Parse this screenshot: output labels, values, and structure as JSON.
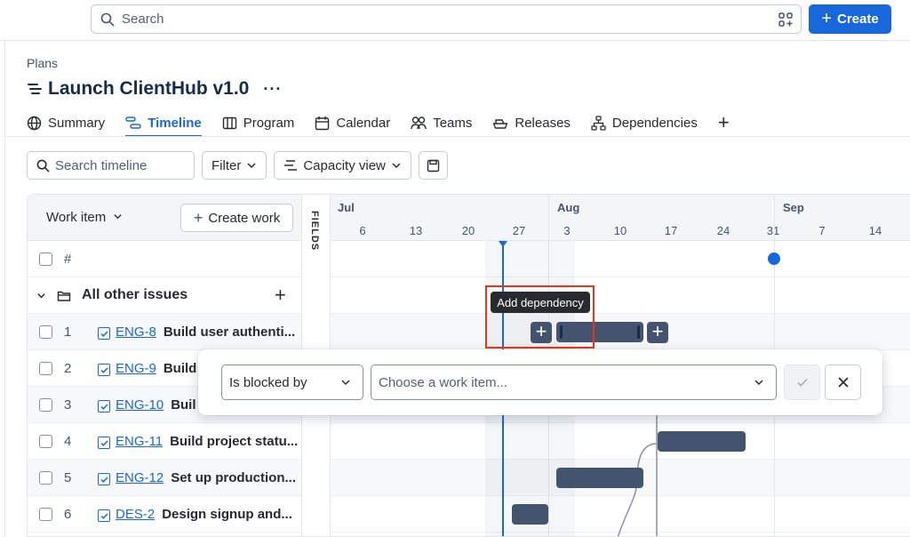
{
  "topbar": {
    "search_placeholder": "Search",
    "create_label": "Create",
    "plus_glyph": "+"
  },
  "page": {
    "breadcrumb": "Plans",
    "title": "Launch ClientHub v1.0",
    "more_glyph": "···"
  },
  "tabs": [
    {
      "label": "Summary",
      "icon": "globe-icon"
    },
    {
      "label": "Timeline",
      "icon": "timeline-icon",
      "active": true
    },
    {
      "label": "Program",
      "icon": "columns-icon"
    },
    {
      "label": "Calendar",
      "icon": "calendar-icon"
    },
    {
      "label": "Teams",
      "icon": "people-icon"
    },
    {
      "label": "Releases",
      "icon": "ship-icon"
    },
    {
      "label": "Dependencies",
      "icon": "hierarchy-icon"
    }
  ],
  "add_tab_glyph": "+",
  "toolbar": {
    "search_placeholder": "Search timeline",
    "filter_label": "Filter",
    "capacity_label": "Capacity view"
  },
  "list": {
    "header_label": "Work item",
    "create_work_label": "Create work",
    "fields_label": "FIELDS",
    "number_header": "#",
    "group_label": "All other issues"
  },
  "rows": [
    {
      "num": "1",
      "key": "ENG-8",
      "summary": "Build user authenti..."
    },
    {
      "num": "2",
      "key": "ENG-9",
      "summary": "Build"
    },
    {
      "num": "3",
      "key": "ENG-10",
      "summary": "Buil"
    },
    {
      "num": "4",
      "key": "ENG-11",
      "summary": "Build project statu..."
    },
    {
      "num": "5",
      "key": "ENG-12",
      "summary": "Set up production..."
    },
    {
      "num": "6",
      "key": "DES-2",
      "summary": "Design signup and..."
    }
  ],
  "timeline": {
    "months": [
      "Jul",
      "Aug",
      "Sep"
    ],
    "days": [
      "6",
      "13",
      "20",
      "27",
      "3",
      "10",
      "17",
      "24",
      "31",
      "7",
      "14"
    ]
  },
  "tooltip": "Add dependency",
  "dependency": {
    "type_value": "Is blocked by",
    "item_placeholder": "Choose a work item..."
  },
  "colors": {
    "accent": "#1868db",
    "bar": "#44546f",
    "highlight": "#e5371b"
  }
}
